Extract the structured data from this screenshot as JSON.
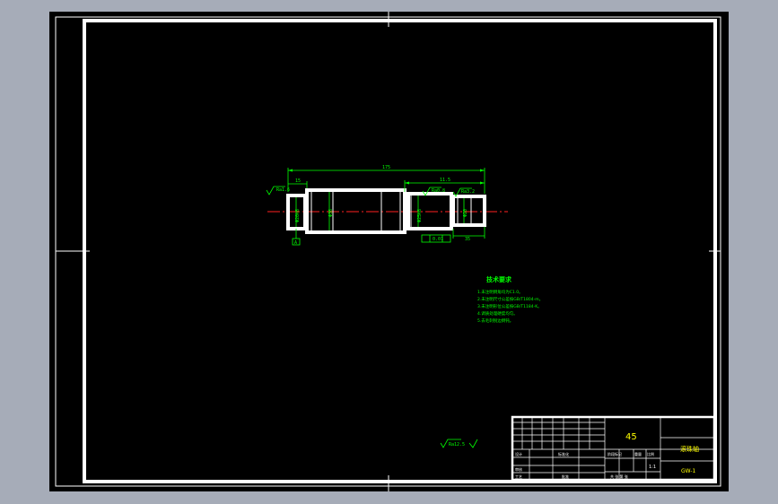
{
  "drawing": {
    "material": "45",
    "part_name": "滚珠轴",
    "drawing_number": "GW-1",
    "scale": "1:1",
    "tech_title": "技术要求",
    "tech_notes": [
      "1.未注明倒角均为C1.0。",
      "2.未注明尺寸公差按GB/T1804-m。",
      "3.未注明形位公差按GB/T1184-K。",
      "4.调质处理硬度均匀。",
      "5.去毛刺锐边倒钝。"
    ],
    "dims": {
      "overall": "175",
      "left_step": "15",
      "right_span": "11.5",
      "right_end": "35",
      "main_dia": "Φ36",
      "left_dia": "Φ20k6",
      "mid_dia": "Φ25k6",
      "right_dia": "Φ20"
    },
    "roughness": {
      "left": "Ra1.6",
      "mid": "Ra0.8",
      "right": "Ra3.2",
      "general": "Ra12.5"
    },
    "tolerance": "0.01",
    "datum": "A",
    "title_block_labels": {
      "process": "工艺",
      "approve": "批准",
      "design": "设计",
      "check": "审核",
      "standard": "标准化",
      "stage": "阶段标记",
      "weight": "重量",
      "ratio": "比例",
      "sheet": "共 张 第 张"
    }
  }
}
